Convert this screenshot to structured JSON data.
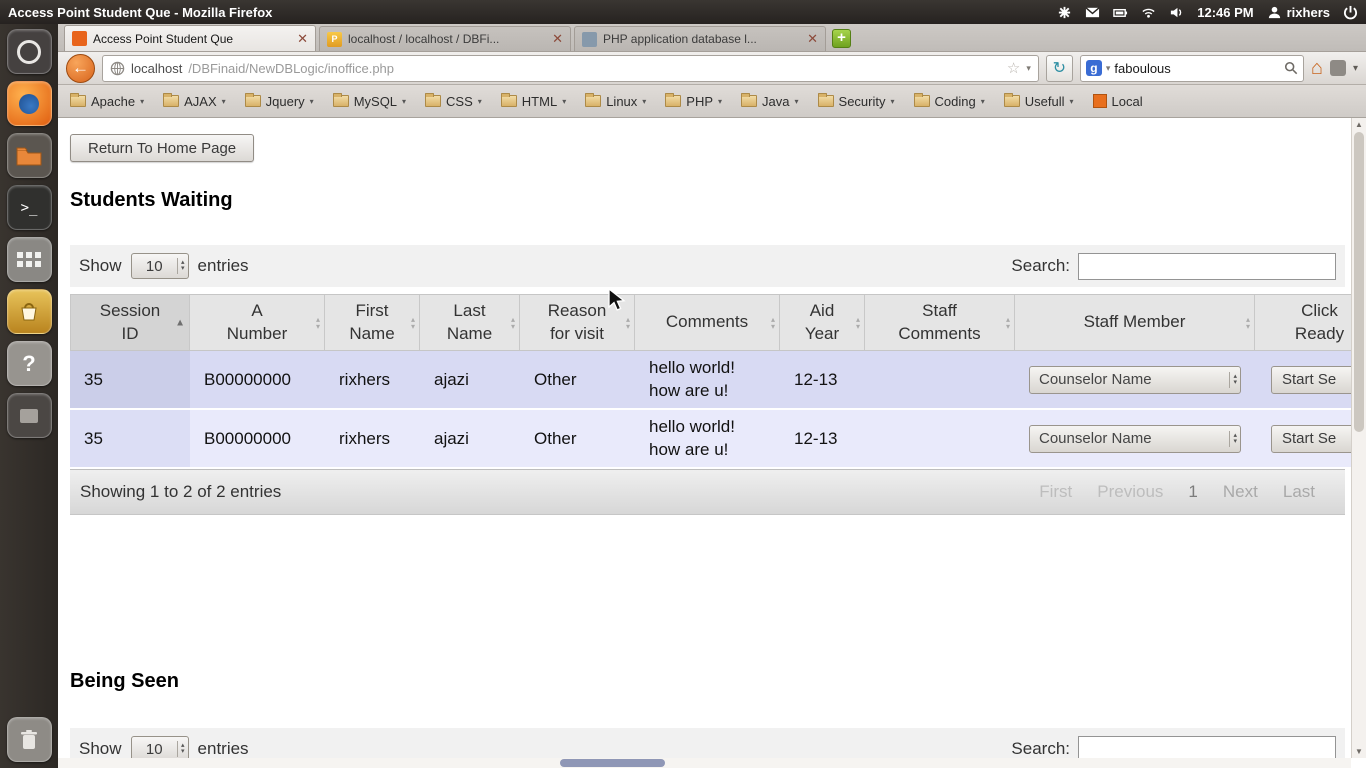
{
  "system_bar": {
    "window_title": "Access Point Student Que - Mozilla Firefox",
    "clock": "12:46 PM",
    "username": "rixhers"
  },
  "browser": {
    "tabs": [
      {
        "label": "Access Point Student Que"
      },
      {
        "label": "localhost / localhost / DBFi..."
      },
      {
        "label": "PHP application database l..."
      }
    ],
    "urlbar": {
      "host": "localhost",
      "path": "/DBFinaid/NewDBLogic/inoffice.php"
    },
    "search": {
      "value": "faboulous"
    },
    "bookmarks": [
      {
        "label": "Apache"
      },
      {
        "label": "AJAX"
      },
      {
        "label": "Jquery"
      },
      {
        "label": "MySQL"
      },
      {
        "label": "CSS"
      },
      {
        "label": "HTML"
      },
      {
        "label": "Linux"
      },
      {
        "label": "PHP"
      },
      {
        "label": "Java"
      },
      {
        "label": "Security"
      },
      {
        "label": "Coding"
      },
      {
        "label": "Usefull"
      },
      {
        "label": "Local"
      }
    ]
  },
  "page": {
    "return_button": "Return To Home Page",
    "waiting": {
      "title": "Students Waiting",
      "show_label": "Show",
      "page_size": "10",
      "entries_label": "entries",
      "search_label": "Search:",
      "columns": [
        "Session ID",
        "A Number",
        "First Name",
        "Last Name",
        "Reason for visit",
        "Comments",
        "Aid Year",
        "Staff Comments",
        "Staff Member",
        "Click Ready"
      ],
      "rows": [
        {
          "session_id": "35",
          "a_number": "B00000000",
          "first_name": "rixhers",
          "last_name": "ajazi",
          "reason": "Other",
          "comments_line1": "hello world!",
          "comments_line2": "how are u!",
          "aid_year": "12-13",
          "staff_comments": "",
          "staff_member": "Counselor Name",
          "action": "Start Se"
        },
        {
          "session_id": "35",
          "a_number": "B00000000",
          "first_name": "rixhers",
          "last_name": "ajazi",
          "reason": "Other",
          "comments_line1": "hello world!",
          "comments_line2": "how are u!",
          "aid_year": "12-13",
          "staff_comments": "",
          "staff_member": "Counselor Name",
          "action": "Start Se"
        }
      ],
      "info": "Showing 1 to 2 of 2 entries",
      "pagination": {
        "first": "First",
        "previous": "Previous",
        "page": "1",
        "next": "Next",
        "last": "Last"
      }
    },
    "seen": {
      "title": "Being Seen",
      "show_label": "Show",
      "page_size": "10",
      "entries_label": "entries",
      "search_label": "Search:"
    }
  },
  "colors": {
    "row_odd": "#d8daf3",
    "row_even": "#e9eafb",
    "launcher_accent": "#e8641b"
  }
}
